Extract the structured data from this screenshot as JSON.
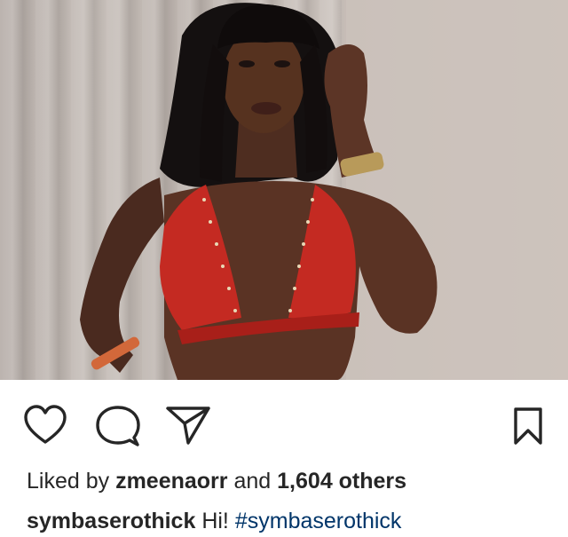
{
  "post": {
    "image_alt": "Woman with long black hair and bangs wearing a red studded bikini top, hand raised to her hair, gold watch on wrist, beige curtain background",
    "colors": {
      "bikini": "#c42a22",
      "hashtag": "#003569",
      "text": "#262626"
    }
  },
  "actions": {
    "like_icon": "heart-icon",
    "comment_icon": "comment-icon",
    "share_icon": "paper-plane-icon",
    "save_icon": "bookmark-icon"
  },
  "likes": {
    "prefix": "Liked by",
    "user": "zmeenaorr",
    "conjunction": "and",
    "count": "1,604 others"
  },
  "caption": {
    "username": "symbaserothick",
    "text": "Hi!",
    "hashtag": "#symbaserothick"
  }
}
